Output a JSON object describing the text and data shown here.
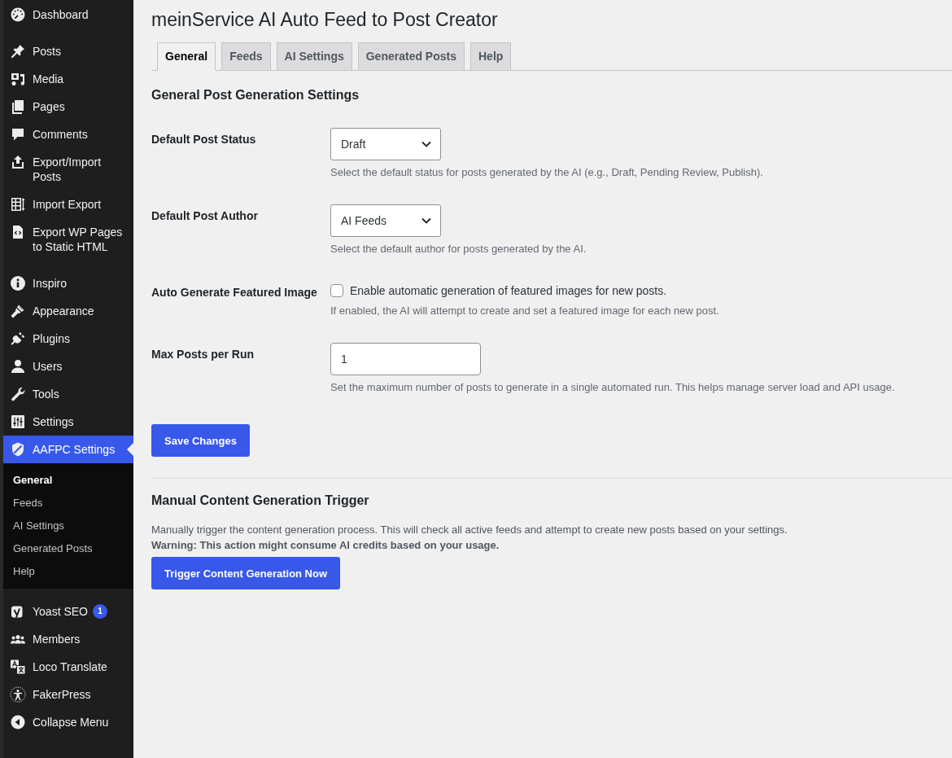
{
  "sidebar": {
    "groups": [
      {
        "items": [
          {
            "label": "Dashboard",
            "selected": false
          }
        ]
      },
      {
        "items": [
          {
            "label": "Posts",
            "selected": false
          },
          {
            "label": "Media",
            "selected": false
          },
          {
            "label": "Pages",
            "selected": false
          },
          {
            "label": "Comments",
            "selected": false
          },
          {
            "label": "Export/Import Posts",
            "selected": false
          },
          {
            "label": "Import Export",
            "selected": false
          },
          {
            "label": "Export WP Pages to Static HTML",
            "selected": false
          }
        ]
      },
      {
        "items": [
          {
            "label": "Inspiro",
            "selected": false
          },
          {
            "label": "Appearance",
            "selected": false
          },
          {
            "label": "Plugins",
            "selected": false
          },
          {
            "label": "Users",
            "selected": false
          },
          {
            "label": "Tools",
            "selected": false
          },
          {
            "label": "Settings",
            "selected": false
          },
          {
            "label": "AAFPC Settings",
            "selected": true,
            "children": [
              {
                "label": "General",
                "selected": true
              },
              {
                "label": "Feeds",
                "selected": false
              },
              {
                "label": "AI Settings",
                "selected": false
              },
              {
                "label": "Generated Posts",
                "selected": false
              },
              {
                "label": "Help",
                "selected": false
              }
            ]
          }
        ]
      },
      {
        "items": [
          {
            "label": "Yoast SEO",
            "selected": false,
            "badge": "1"
          },
          {
            "label": "Members",
            "selected": false
          },
          {
            "label": "Loco Translate",
            "selected": false
          },
          {
            "label": "FakerPress",
            "selected": false
          }
        ]
      }
    ],
    "collapse_menu": {
      "label": "Collapse Menu"
    }
  },
  "page_title": "meinService AI Auto Feed to Post Creator",
  "tabs": [
    {
      "label": "General",
      "selected": true
    },
    {
      "label": "Feeds",
      "selected": false
    },
    {
      "label": "AI Settings",
      "selected": false
    },
    {
      "label": "Generated Posts",
      "selected": false
    },
    {
      "label": "Help",
      "selected": false
    }
  ],
  "settings": {
    "heading": "General Post Generation Settings",
    "rows": [
      {
        "kind": "select",
        "label": "Default Post Status",
        "value": "Draft",
        "description": "Select the default status for posts generated by the AI (e.g., Draft, Pending Review, Publish)."
      },
      {
        "kind": "select",
        "label": "Default Post Author",
        "value": "AI Feeds",
        "description": "Select the default author for posts generated by the AI."
      },
      {
        "kind": "checkbox",
        "label": "Auto Generate Featured Image",
        "checked": false,
        "option_label": "Enable automatic generation of featured images for new posts.",
        "description": "If enabled, the AI will attempt to create and set a featured image for each new post."
      },
      {
        "kind": "input",
        "label": "Max Posts per Run",
        "value": "1",
        "description": "Set the maximum number of posts to generate in a single automated run. This helps manage server load and API usage."
      }
    ],
    "save_button": "Save Changes"
  },
  "manual": {
    "heading": "Manual Content Generation Trigger",
    "description": "Manually trigger the content generation process. This will check all active feeds and attempt to create new posts based on your settings.",
    "warning": "Warning: This action might consume AI credits based on your usage.",
    "button": "Trigger Content Generation Now"
  }
}
